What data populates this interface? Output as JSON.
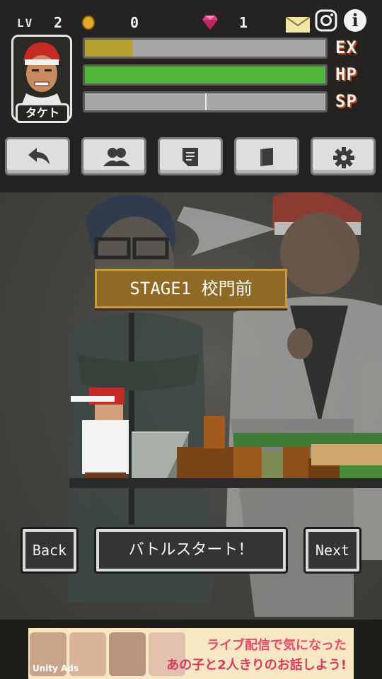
{
  "hud": {
    "level_label": "LV",
    "level_value": "2",
    "coins": "0",
    "gems": "1",
    "character_name": "タケト",
    "bars": {
      "ex": {
        "label": "EX",
        "fill": 0.2,
        "color": "#b7a032"
      },
      "hp": {
        "label": "HP",
        "fill": 1.0,
        "color": "#4fb63b"
      },
      "sp": {
        "label": "SP",
        "fill": 0.0,
        "color": "#a7a7a7"
      }
    }
  },
  "toolbar": {
    "items": [
      {
        "icon": "back-arrow-icon"
      },
      {
        "icon": "users-icon"
      },
      {
        "icon": "document-icon"
      },
      {
        "icon": "book-icon"
      },
      {
        "icon": "gear-icon"
      }
    ]
  },
  "stage": {
    "title": "STAGE1 校門前"
  },
  "nav": {
    "back_label": "Back",
    "battle_start_label": "バトルスタート！",
    "next_label": "Next"
  },
  "ad": {
    "headline_1": "ライブ配信で気になった",
    "headline_2": "あの子と2人きりのお話しよう!",
    "provider": "Unity Ads"
  }
}
